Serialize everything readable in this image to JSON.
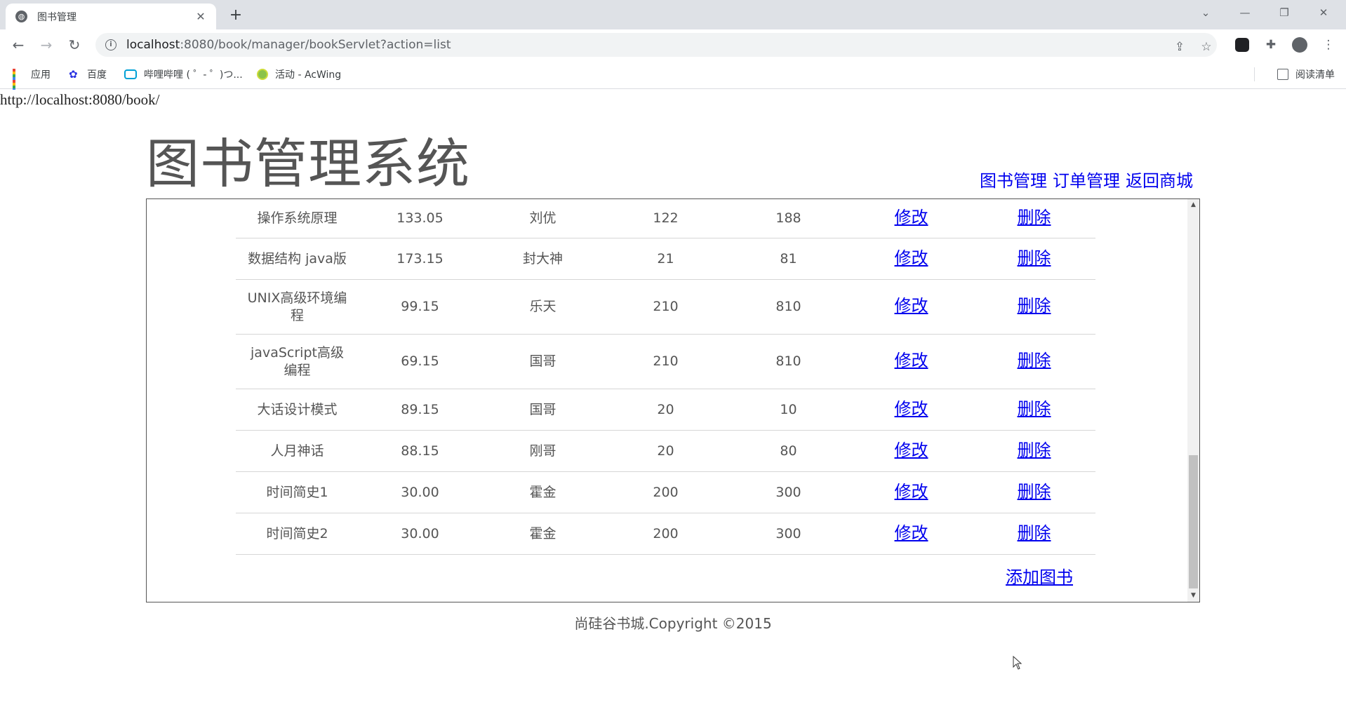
{
  "browser": {
    "tab_title": "图书管理",
    "url_host": "localhost",
    "url_path": ":8080/book/manager/bookServlet?action=list",
    "bookmarks": [
      {
        "label": "应用",
        "icon": "apps-grid-icon"
      },
      {
        "label": "百度",
        "icon": "baidu-icon"
      },
      {
        "label": "哔哩哔哩 ( ゜- ゜)つ...",
        "icon": "bilibili-icon"
      },
      {
        "label": "活动 - AcWing",
        "icon": "acwing-icon"
      }
    ],
    "reading_list": "阅读清单"
  },
  "page": {
    "base_url": "http://localhost:8080/book/",
    "logo_text": "图书管理系统",
    "nav": [
      "图书管理",
      "订单管理",
      "返回商城"
    ],
    "footer": "尚硅谷书城.Copyright ©2015",
    "add_book": "添加图书"
  },
  "books": [
    {
      "name": "操作系统原理",
      "price": "133.05",
      "author": "刘优",
      "sales": "122",
      "stock": "188",
      "edit": "修改",
      "delete": "删除"
    },
    {
      "name": "数据结构 java版",
      "price": "173.15",
      "author": "封大神",
      "sales": "21",
      "stock": "81",
      "edit": "修改",
      "delete": "删除"
    },
    {
      "name": "UNIX高级环境编程",
      "price": "99.15",
      "author": "乐天",
      "sales": "210",
      "stock": "810",
      "edit": "修改",
      "delete": "删除"
    },
    {
      "name": "javaScript高级编程",
      "price": "69.15",
      "author": "国哥",
      "sales": "210",
      "stock": "810",
      "edit": "修改",
      "delete": "删除"
    },
    {
      "name": "大话设计模式",
      "price": "89.15",
      "author": "国哥",
      "sales": "20",
      "stock": "10",
      "edit": "修改",
      "delete": "删除"
    },
    {
      "name": "人月神话",
      "price": "88.15",
      "author": "刚哥",
      "sales": "20",
      "stock": "80",
      "edit": "修改",
      "delete": "删除"
    },
    {
      "name": "时间简史1",
      "price": "30.00",
      "author": "霍金",
      "sales": "200",
      "stock": "300",
      "edit": "修改",
      "delete": "删除"
    },
    {
      "name": "时间简史2",
      "price": "30.00",
      "author": "霍金",
      "sales": "200",
      "stock": "300",
      "edit": "修改",
      "delete": "删除"
    }
  ],
  "colors": {
    "link": "#0000ee",
    "text": "#555555",
    "chrome_bg": "#dee1e6"
  }
}
